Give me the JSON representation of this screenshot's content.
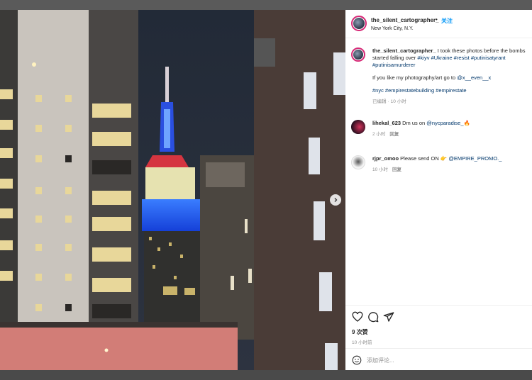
{
  "post": {
    "username": "the_silent_cartographer_",
    "separator": "•",
    "follow_label": "关注",
    "location": "New York City, N.Y."
  },
  "caption": {
    "username": "the_silent_cartographer_",
    "text_1": " I took these photos before the bombs started falling over ",
    "tags_1": [
      "#kiyv",
      "#Ukraine",
      "#resist",
      "#putinisatyrant",
      "#putinisamurderer"
    ],
    "text_2": "If you like my photography/art go to ",
    "mention": "@x__even__x",
    "tags_2": [
      "#nyc",
      "#empirestatebuilding",
      "#empirestate"
    ],
    "edited": "已编辑",
    "dot": "·",
    "time": "10 小时"
  },
  "comments": [
    {
      "username": "lihekal_623",
      "text": " Dm us on ",
      "mention": "@nycparadise_",
      "emoji": "🔥",
      "time": "2 小时",
      "reply": "回复"
    },
    {
      "username": "rjpr_omoo",
      "text": " Please send ON ",
      "emoji": "👉",
      "mention": "@EMPIRE_PROMO._",
      "time": "10 小时",
      "reply": "回复"
    }
  ],
  "actions": {
    "icons": [
      "heart-icon",
      "comment-icon",
      "share-icon"
    ],
    "likes": "9 次赞",
    "time": "10 小时前"
  },
  "add_comment": {
    "placeholder": "添加评论..."
  },
  "colors": {
    "follow": "#0095f6",
    "link": "#00376b",
    "muted": "#8e8e8e",
    "text": "#262626",
    "ring": "#d62976"
  }
}
